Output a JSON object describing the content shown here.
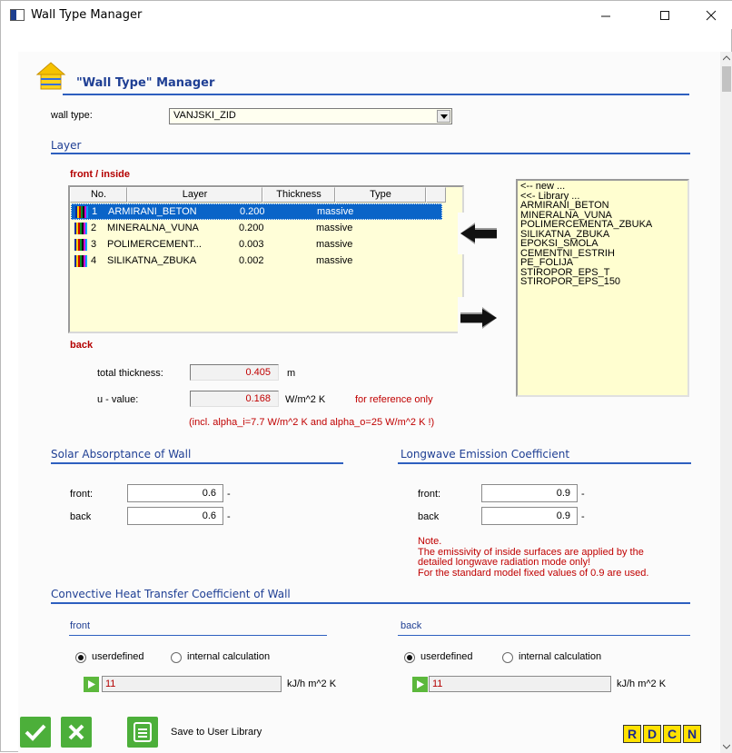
{
  "window": {
    "title": "Wall Type Manager"
  },
  "header": {
    "title": "\"Wall Type\" Manager"
  },
  "wall_type": {
    "label": "wall type:",
    "value": "VANJSKI_ZID"
  },
  "layer": {
    "section_title": "Layer",
    "front_label": "front / inside",
    "back_label": "back",
    "columns": [
      "No.",
      "Layer",
      "Thickness",
      "Type"
    ],
    "rows": [
      {
        "no": "1",
        "layer": "ARMIRANI_BETON",
        "thickness": "0.200",
        "type": "massive",
        "selected": true
      },
      {
        "no": "2",
        "layer": "MINERALNA_VUNA",
        "thickness": "0.200",
        "type": "massive",
        "selected": false
      },
      {
        "no": "3",
        "layer": "POLIMERCEMENT...",
        "thickness": "0.003",
        "type": "massive",
        "selected": false
      },
      {
        "no": "4",
        "layer": "SILIKATNA_ZBUKA",
        "thickness": "0.002",
        "type": "massive",
        "selected": false
      }
    ],
    "library": [
      "<-- new ...",
      "<<- Library ...",
      "ARMIRANI_BETON",
      "MINERALNA_VUNA",
      "POLIMERCEMENTA_ZBUKA",
      "SILIKATNA_ZBUKA",
      "EPOKSI_SMOLA",
      "CEMENTNI_ESTRIH",
      "PE_FOLIJA",
      "STIROPOR_EPS_T",
      "STIROPOR_EPS_150"
    ],
    "total_thickness": {
      "label": "total thickness:",
      "value": "0.405",
      "unit": "m"
    },
    "u_value": {
      "label": "u - value:",
      "value": "0.168",
      "unit": "W/m^2 K",
      "note": "for reference only"
    },
    "alpha_note": "(incl. alpha_i=7.7 W/m^2 K and alpha_o=25 W/m^2 K !)"
  },
  "solar": {
    "title": "Solar Absorptance of Wall",
    "front_label": "front:",
    "front_value": "0.6",
    "back_label": "back",
    "back_value": "0.6",
    "unit": "-"
  },
  "longwave": {
    "title": "Longwave Emission Coefficient",
    "front_label": "front:",
    "front_value": "0.9",
    "back_label": "back",
    "back_value": "0.9",
    "unit": "-",
    "note_lines": [
      "Note.",
      "The emissivity of inside surfaces are applied by the",
      "detailed longwave radiation mode only!",
      "For the standard model fixed values of 0.9 are used."
    ]
  },
  "convective": {
    "title": "Convective Heat Transfer Coefficient of Wall",
    "front": {
      "label": "front",
      "opt_user": "userdefined",
      "opt_internal": "internal calculation",
      "value": "11",
      "unit": "kJ/h m^2 K"
    },
    "back": {
      "label": "back",
      "opt_user": "userdefined",
      "opt_internal": "internal calculation",
      "value": "11",
      "unit": "kJ/h m^2 K"
    }
  },
  "footer": {
    "save_label": "Save to User Library",
    "mode_buttons": [
      "R",
      "D",
      "C",
      "N"
    ]
  },
  "colors": {
    "accent_blue": "#1f3f94",
    "selection": "#0a64c8",
    "list_bg": "#fffed0",
    "warning_red": "#c00000",
    "ok_green": "#4caf3a",
    "mode_yellow": "#ffe100"
  }
}
